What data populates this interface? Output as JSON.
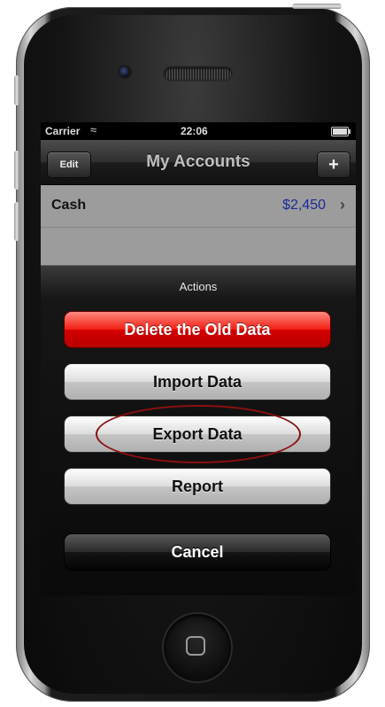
{
  "status_bar": {
    "carrier": "Carrier",
    "time": "22:06"
  },
  "nav_bar": {
    "edit_label": "Edit",
    "title": "My Accounts",
    "add_label": "+"
  },
  "accounts": [
    {
      "name": "Cash",
      "balance": "$2,450"
    }
  ],
  "action_sheet": {
    "title": "Actions",
    "buttons": {
      "delete": "Delete the Old Data",
      "import": "Import Data",
      "export": "Export Data",
      "report": "Report",
      "cancel": "Cancel"
    }
  },
  "colors": {
    "destructive": "#e00000",
    "balance_text": "#1a2a9a",
    "highlight_ring": "#8b1010"
  }
}
